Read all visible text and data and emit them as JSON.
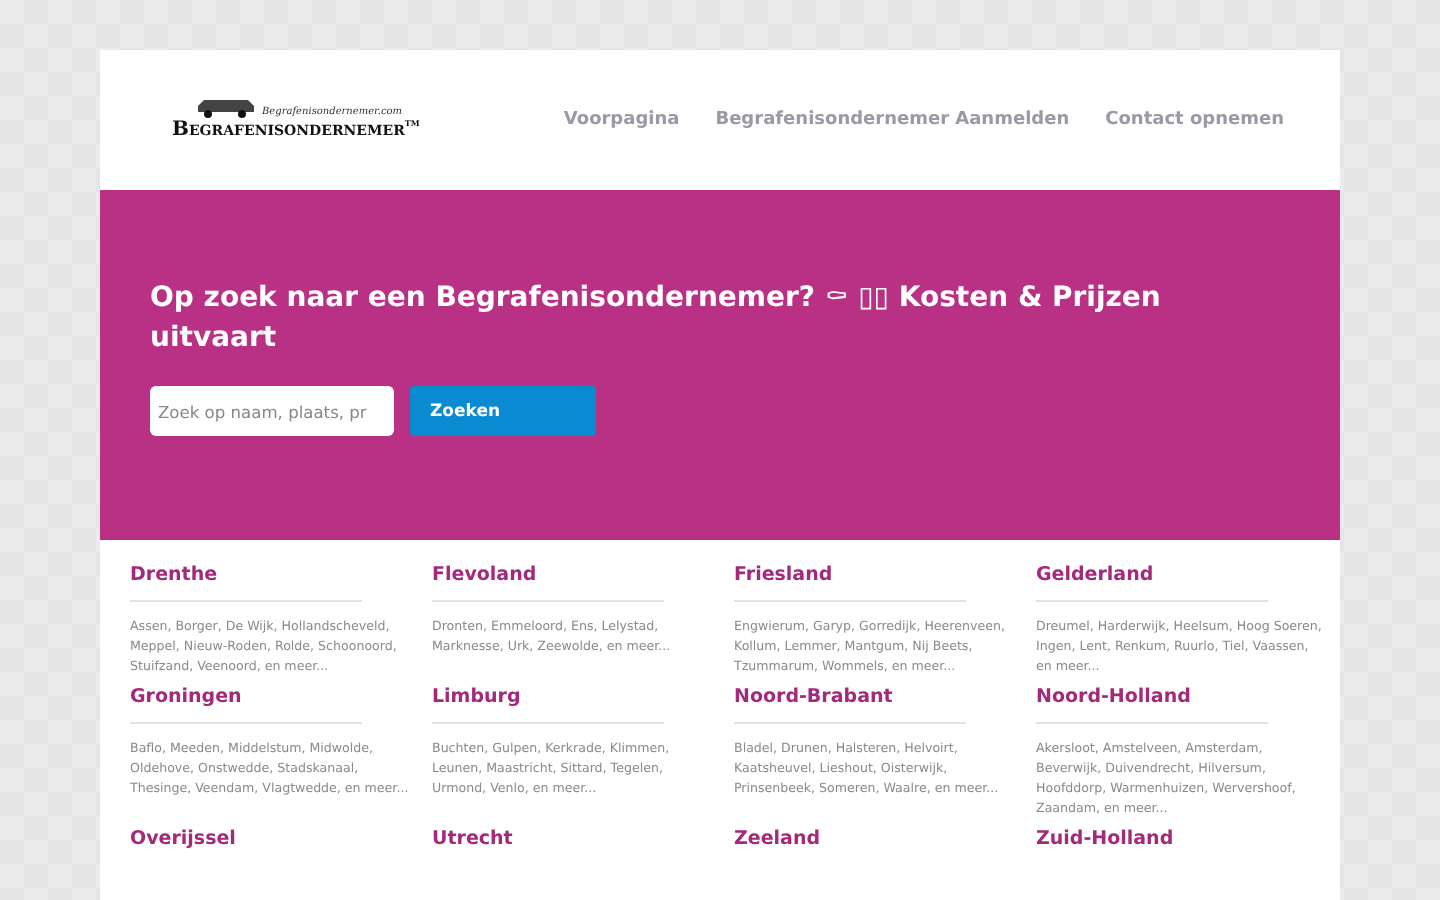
{
  "logo": {
    "tagline": "Begrafenisondernemer.com",
    "name": "Begrafenisondernemer",
    "mark": "TM"
  },
  "nav": [
    "Voorpagina",
    "Begrafenisondernemer Aanmelden",
    "Contact opnemen"
  ],
  "hero": {
    "title": "Op zoek naar een Begrafenisondernemer? ⚰ ▯▯ Kosten & Prijzen uitvaart",
    "search": {
      "placeholder": "Zoek op naam, plaats, pr"
    },
    "button": "Zoeken"
  },
  "provinces": [
    {
      "name": "Drenthe",
      "places": "Assen, Borger, De Wijk, Hollandscheveld, Meppel, Nieuw-Roden, Rolde, Schoonoord, Stuifzand, Veenoord, en meer..."
    },
    {
      "name": "Flevoland",
      "places": "Dronten, Emmeloord, Ens, Lelystad, Marknesse, Urk, Zeewolde, en meer..."
    },
    {
      "name": "Friesland",
      "places": "Engwierum, Garyp, Gorredijk, Heerenveen, Kollum, Lemmer, Mantgum, Nij Beets, Tzummarum, Wommels, en meer..."
    },
    {
      "name": "Gelderland",
      "places": "Dreumel, Harderwijk, Heelsum, Hoog Soeren, Ingen, Lent, Renkum, Ruurlo, Tiel, Vaassen, en meer..."
    },
    {
      "name": "Groningen",
      "places": "Baflo, Meeden, Middelstum, Midwolde, Oldehove, Onstwedde, Stadskanaal, Thesinge, Veendam, Vlagtwedde, en meer..."
    },
    {
      "name": "Limburg",
      "places": "Buchten, Gulpen, Kerkrade, Klimmen, Leunen, Maastricht, Sittard, Tegelen, Urmond, Venlo, en meer..."
    },
    {
      "name": "Noord-Brabant",
      "places": "Bladel, Drunen, Halsteren, Helvoirt, Kaatsheuvel, Lieshout, Oisterwijk, Prinsenbeek, Someren, Waalre, en meer..."
    },
    {
      "name": "Noord-Holland",
      "places": "Akersloot, Amstelveen, Amsterdam, Beverwijk, Duivendrecht, Hilversum, Hoofddorp, Warmenhuizen, Wervershoof, Zaandam, en meer..."
    },
    {
      "name": "Overijssel"
    },
    {
      "name": "Utrecht"
    },
    {
      "name": "Zeeland"
    },
    {
      "name": "Zuid-Holland"
    }
  ]
}
